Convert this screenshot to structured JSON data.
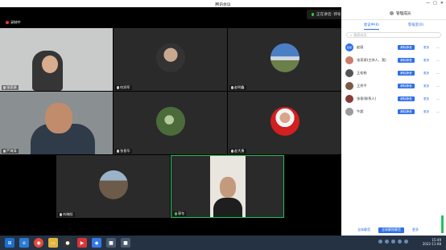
{
  "window": {
    "title": "腾讯会议",
    "controls": [
      "—",
      "□",
      "✕"
    ]
  },
  "recording": {
    "label": "录制中"
  },
  "speaking": {
    "label": "正在讲话: 郭冬"
  },
  "panel_header": {
    "title": "管理成员"
  },
  "panel_tabs": [
    {
      "label": "会议中(6)"
    },
    {
      "label": "等候室(0)"
    }
  ],
  "panel_search": {
    "placeholder": "搜索成员"
  },
  "members": [
    {
      "name": "赵丽",
      "avatar_color": "#2f6fe8",
      "avatar_text": "赵丽",
      "unmute": "解除静音",
      "more": "更多"
    },
    {
      "name": "张家源(主持人、我)",
      "avatar_color": "#c97d6a",
      "avatar_text": "",
      "unmute": "解除静音",
      "more": "更多"
    },
    {
      "name": "王松柏",
      "avatar_color": "#555",
      "avatar_text": "",
      "unmute": "解除静音",
      "more": "更多"
    },
    {
      "name": "王秀平",
      "avatar_color": "#7a5a44",
      "avatar_text": "",
      "unmute": "解除静音",
      "more": "更多"
    },
    {
      "name": "张晋(联系人)",
      "avatar_color": "#8b3a3a",
      "avatar_text": "",
      "unmute": "解除静音",
      "more": "更多"
    },
    {
      "name": "牛超",
      "avatar_color": "#9b9b9b",
      "avatar_text": "",
      "unmute": "解除静音",
      "more": "更多"
    }
  ],
  "panel_footer": {
    "mute_all": "全体静音",
    "unmute_all": "全体解除静音",
    "more": "更多"
  },
  "tiles": [
    {
      "name": "张家源"
    },
    {
      "name": "何润军"
    },
    {
      "name": "赵明鑫"
    },
    {
      "name": "严海涛"
    },
    {
      "name": "张晋华"
    },
    {
      "name": "赵大勇"
    },
    {
      "name": "刘晓阳"
    },
    {
      "name": "郭冬"
    }
  ],
  "taskbar": {
    "time": "15:49",
    "date": "2022-11-08"
  }
}
